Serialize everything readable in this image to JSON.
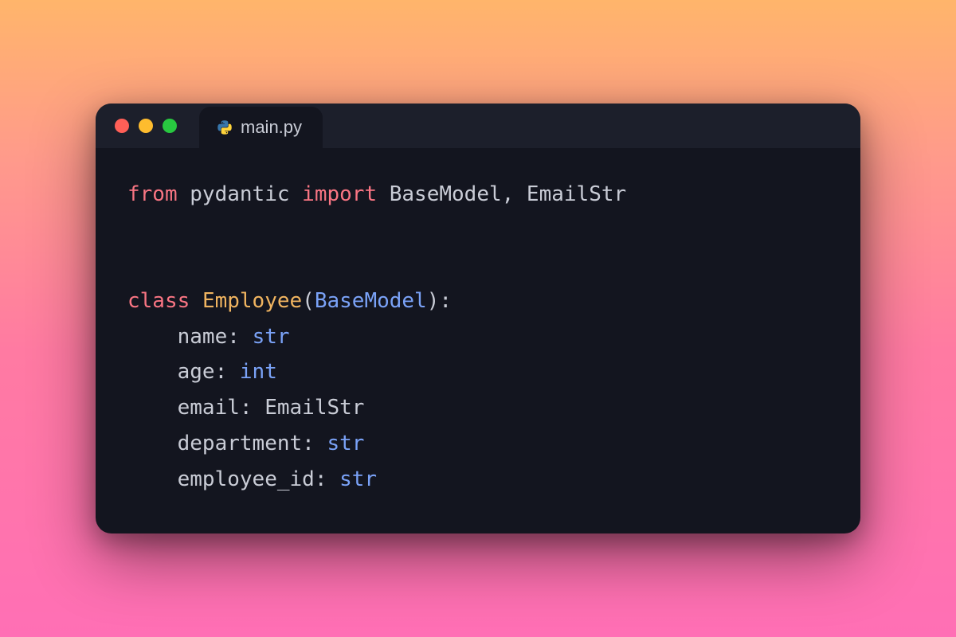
{
  "tab": {
    "filename": "main.py",
    "language": "python"
  },
  "code": {
    "line1": {
      "kw_from": "from",
      "module": "pydantic",
      "kw_import": "import",
      "imports": "BaseModel, EmailStr"
    },
    "line4": {
      "kw_class": "class",
      "classname": "Employee",
      "lparen": "(",
      "base": "BaseModel",
      "rparen_colon": "):"
    },
    "line5": {
      "indent": "    ",
      "field": "name",
      "colon_sp": ": ",
      "type": "str"
    },
    "line6": {
      "indent": "    ",
      "field": "age",
      "colon_sp": ": ",
      "type": "int"
    },
    "line7": {
      "indent": "    ",
      "field": "email",
      "colon_sp": ": ",
      "type": "EmailStr"
    },
    "line8": {
      "indent": "    ",
      "field": "department",
      "colon_sp": ": ",
      "type": "str"
    },
    "line9": {
      "indent": "    ",
      "field": "employee_id",
      "colon_sp": ": ",
      "type": "str"
    }
  }
}
